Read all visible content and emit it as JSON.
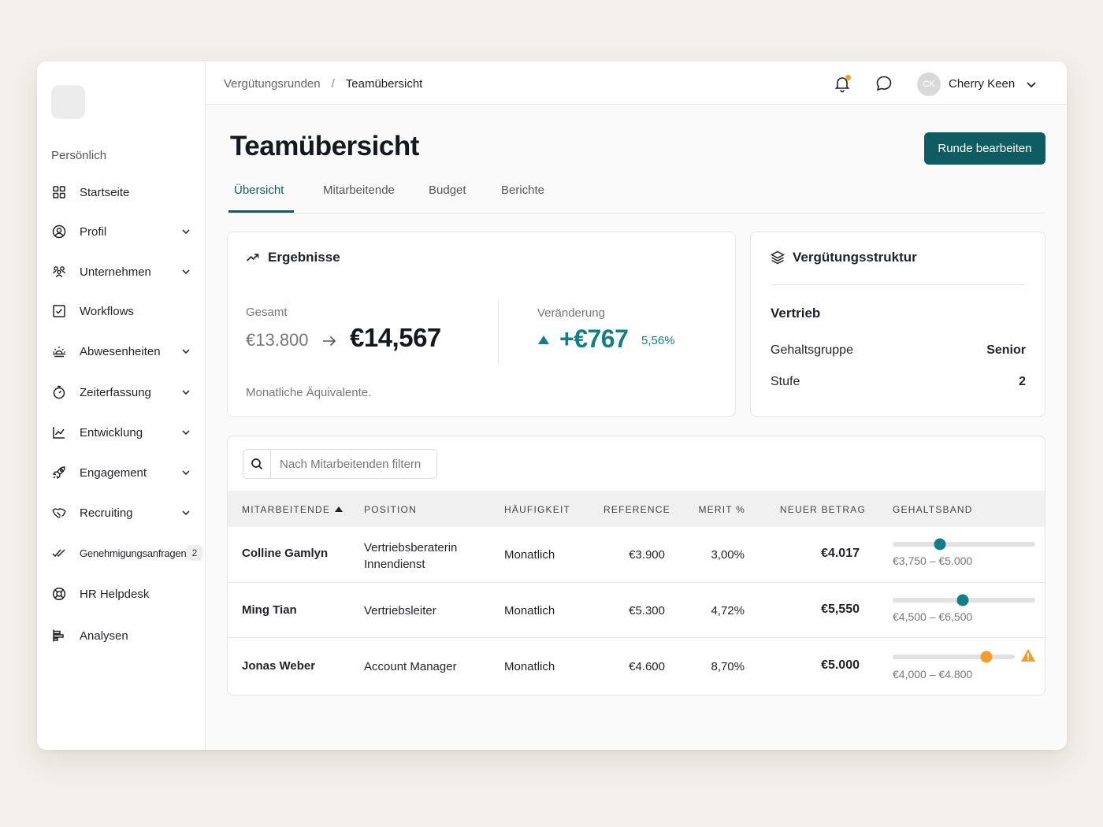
{
  "sidebar": {
    "section": "Persönlich",
    "items": [
      {
        "label": "Startseite",
        "icon": "grid-icon",
        "chevron": false
      },
      {
        "label": "Profil",
        "icon": "user-circle-icon",
        "chevron": true
      },
      {
        "label": "Unternehmen",
        "icon": "people-icon",
        "chevron": true
      },
      {
        "label": "Workflows",
        "icon": "checkbox-icon",
        "chevron": false
      },
      {
        "label": "Abwesenheiten",
        "icon": "sunset-icon",
        "chevron": true
      },
      {
        "label": "Zeiterfassung",
        "icon": "stopwatch-icon",
        "chevron": true
      },
      {
        "label": "Entwicklung",
        "icon": "trend-chart-icon",
        "chevron": true
      },
      {
        "label": "Engagement",
        "icon": "rocket-icon",
        "chevron": true
      },
      {
        "label": "Recruiting",
        "icon": "handshake-icon",
        "chevron": true
      },
      {
        "label": "Genehmigungsanfragen",
        "icon": "double-check-icon",
        "chevron": false,
        "badge": "2"
      },
      {
        "label": "HR Helpdesk",
        "icon": "lifebuoy-icon",
        "chevron": false
      },
      {
        "label": "Analysen",
        "icon": "bar-chart-icon",
        "chevron": false
      }
    ]
  },
  "topbar": {
    "breadcrumb": [
      "Vergütungsrunden",
      "Teamübersicht"
    ],
    "breadcrumb_sep": "/",
    "user": {
      "initials": "CK",
      "name": "Cherry Keen"
    },
    "notification_color": "#f59b2b"
  },
  "page": {
    "title": "Teamübersicht",
    "edit_button": "Runde bearbeiten",
    "tabs": [
      "Übersicht",
      "Mitarbeitende",
      "Budget",
      "Berichte"
    ],
    "active_tab": 0
  },
  "results": {
    "title": "Ergebnisse",
    "total_label": "Gesamt",
    "old_total": "€13.800",
    "new_total": "€14,567",
    "change_label": "Veränderung",
    "change_value": "+€767",
    "change_pct": "5,56%",
    "footnote": "Monatliche Äquivalente."
  },
  "structure": {
    "title": "Vergütungsstruktur",
    "department": "Vertrieb",
    "rows": [
      {
        "label": "Gehaltsgruppe",
        "value": "Senior"
      },
      {
        "label": "Stufe",
        "value": "2"
      }
    ]
  },
  "table": {
    "search_placeholder": "Nach Mitarbeitenden filtern",
    "headers": [
      "MITARBEITENDE",
      "POSITION",
      "HÄUFIGKEIT",
      "REFERENCE",
      "MERIT %",
      "NEUER BETRAG",
      "GEHALTSBAND"
    ],
    "rows": [
      {
        "name": "Colline Gamlyn",
        "position": [
          "Vertriebsberaterin",
          "Innendienst"
        ],
        "frequency": "Monatlich",
        "reference": "€3.900",
        "merit": "3,00%",
        "new_amount": "€4.017",
        "band": "€3,750 – €5.000",
        "band_fraction": 0.33,
        "band_color": "#127f86",
        "warning": false
      },
      {
        "name": "Ming Tian",
        "position": [
          "Vertriebsleiter"
        ],
        "frequency": "Monatlich",
        "reference": "€5.300",
        "merit": "4,72%",
        "new_amount": "€5,550",
        "band": "€4,500 – €6,500",
        "band_fraction": 0.49,
        "band_color": "#127f86",
        "warning": false
      },
      {
        "name": "Jonas Weber",
        "position": [
          "Account Manager"
        ],
        "frequency": "Monatlich",
        "reference": "€4.600",
        "merit": "8,70%",
        "new_amount": "€5.000",
        "band": "€4,000 – €4.800",
        "band_fraction": 0.77,
        "band_color": "#f59b2b",
        "warning": true
      }
    ]
  },
  "colors": {
    "accent": "#0f5c63",
    "positive": "#127f86",
    "warning": "#f59b2b"
  }
}
